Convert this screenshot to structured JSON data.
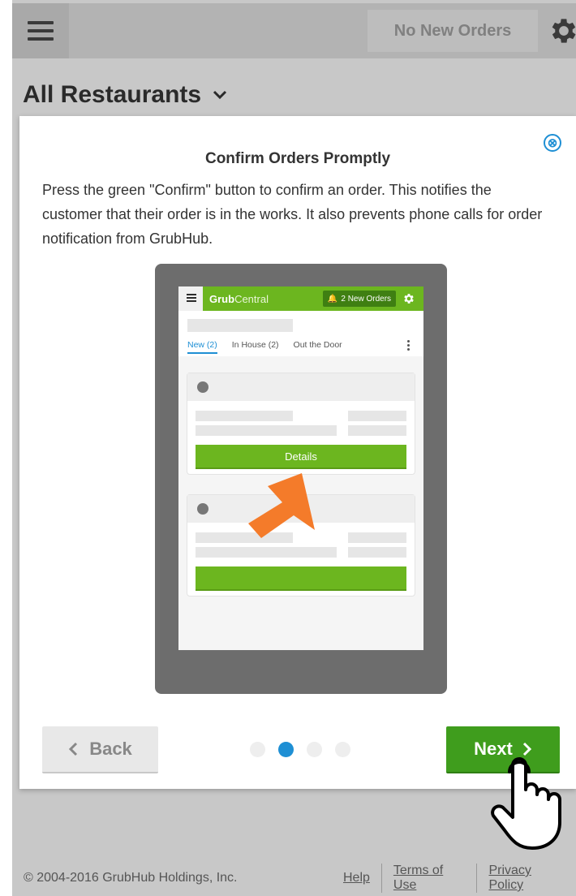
{
  "header": {
    "orders_status": "No New Orders",
    "page_title": "All Restaurants"
  },
  "modal": {
    "title": "Confirm Orders Promptly",
    "body": "Press the green \"Confirm\" button to confirm an order. This notifies the customer that their order is in the works. It also prevents phone calls for order notification from GrubHub.",
    "close_glyph": "⊗",
    "back_label": "Back",
    "next_label": "Next",
    "pagination": {
      "total": 4,
      "current": 2
    }
  },
  "illustration": {
    "logo_bold": "Grub",
    "logo_light": "Central",
    "new_orders_label": "2 New Orders",
    "tabs": [
      "New (2)",
      "In House (2)",
      "Out the Door"
    ],
    "details_label": "Details"
  },
  "footer": {
    "copyright": "© 2004-2016 GrubHub Holdings, Inc.",
    "links": [
      "Help",
      "Terms of Use",
      "Privacy Policy"
    ]
  },
  "colors": {
    "accent_blue": "#1e8fd4",
    "confirm_green": "#3f9d1d",
    "brand_green": "#6cb61f",
    "arrow_orange": "#f47b2a"
  }
}
